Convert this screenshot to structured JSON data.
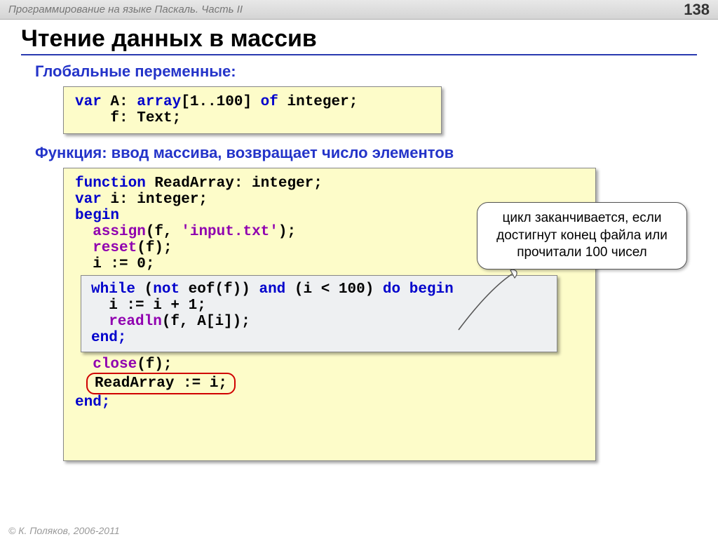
{
  "topbar": {
    "subject": "Программирование на языке Паскаль. Часть II",
    "page": "138"
  },
  "title": "Чтение данных в массив",
  "sub1": "Глобальные переменные:",
  "code1": {
    "l1a": "var",
    "l1b": " A: ",
    "l1c": "array",
    "l1d": "[1..100] ",
    "l1e": "of",
    "l1f": " integer;",
    "l2": "    f: Text;"
  },
  "sub2": "Функция: ввод массива, возвращает число элементов",
  "code2": {
    "l1a": "function",
    "l1b": " ReadArray: integer;",
    "l2a": "var",
    "l2b": " i: integer;",
    "l3": "begin",
    "l4a": "  assign",
    "l4b": "(f, ",
    "l4c": "'input.txt'",
    "l4d": ");",
    "l5a": "  reset",
    "l5b": "(f);",
    "l6": "  i := 0;",
    "gray": {
      "g1a": "while",
      "g1b": " (",
      "g1c": "not",
      "g1d": " eof(f)) ",
      "g1e": "and",
      "g1f": " (i < 100) ",
      "g1g": "do begin",
      "g2": "  i := i + 1;",
      "g3a": "  readln",
      "g3b": "(f, A[i]);",
      "g4": "end;"
    },
    "l7a": "  close",
    "l7b": "(f);",
    "l8": "ReadArray := i;",
    "l9": "end;"
  },
  "callout": "цикл заканчивается, если достигнут конец файла или прочитали 100 чисел",
  "footer": "© К. Поляков, 2006-2011"
}
